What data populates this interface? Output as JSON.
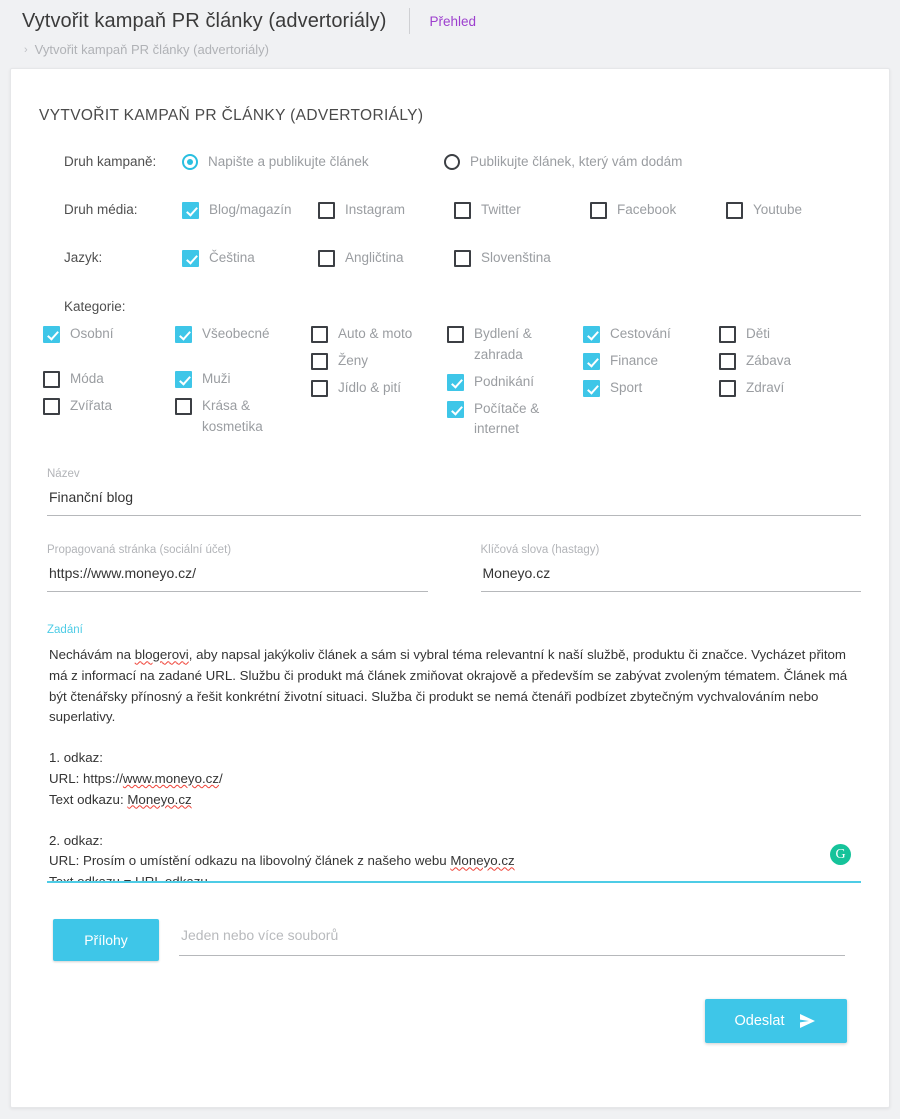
{
  "header": {
    "app_title": "Vytvořit kampaň PR články (advertoriály)",
    "overview_link": "Přehled",
    "breadcrumb_caret": "›",
    "breadcrumb_item": "Vytvořit kampaň PR články (advertoriály)"
  },
  "form": {
    "section_title": "VYTVOŘIT KAMPAŇ PR ČLÁNKY (ADVERTORIÁLY)",
    "campaign_type": {
      "label": "Druh kampaně:",
      "options": [
        {
          "label": "Napište a publikujte článek",
          "selected": true
        },
        {
          "label": "Publikujte článek, který vám dodám",
          "selected": false
        }
      ]
    },
    "media_type": {
      "label": "Druh média:",
      "options": [
        {
          "label": "Blog/magazín",
          "checked": true
        },
        {
          "label": "Instagram",
          "checked": false
        },
        {
          "label": "Twitter",
          "checked": false
        },
        {
          "label": "Facebook",
          "checked": false
        },
        {
          "label": "Youtube",
          "checked": false
        }
      ]
    },
    "language": {
      "label": "Jazyk:",
      "options": [
        {
          "label": "Čeština",
          "checked": true
        },
        {
          "label": "Angličtina",
          "checked": false
        },
        {
          "label": "Slovenština",
          "checked": false
        }
      ]
    },
    "categories": {
      "label": "Kategorie:",
      "columns": [
        [
          {
            "label": "Osobní",
            "checked": true
          },
          {
            "label": "Móda",
            "checked": false
          },
          {
            "label": "Zvířata",
            "checked": false
          }
        ],
        [
          {
            "label": "Všeobecné",
            "checked": true
          },
          {
            "label": "Muži",
            "checked": true
          },
          {
            "label": "Krása & kosmetika",
            "checked": false
          }
        ],
        [
          {
            "label": "Auto & moto",
            "checked": false
          },
          {
            "label": "Ženy",
            "checked": false
          },
          {
            "label": "Jídlo & pití",
            "checked": false
          }
        ],
        [
          {
            "label": "Bydlení & zahrada",
            "checked": false
          },
          {
            "label": "Podnikání",
            "checked": true
          },
          {
            "label": "Počítače & internet",
            "checked": true
          }
        ],
        [
          {
            "label": "Cestování",
            "checked": true
          },
          {
            "label": "Finance",
            "checked": true
          },
          {
            "label": "Sport",
            "checked": true
          }
        ],
        [
          {
            "label": "Děti",
            "checked": false
          },
          {
            "label": "Zábava",
            "checked": false
          },
          {
            "label": "Zdraví",
            "checked": false
          }
        ]
      ]
    },
    "name_field": {
      "label": "Název",
      "value": "Finanční blog",
      "placeholder": ""
    },
    "promoted_page_field": {
      "label": "Propagovaná stránka (sociální účet)",
      "value": "https://www.moneyo.cz/",
      "placeholder": ""
    },
    "keywords_field": {
      "label": "Klíčová slova (hastagy)",
      "value": "Moneyo.cz",
      "placeholder": ""
    },
    "brief": {
      "label": "Zadání",
      "paragraph": "Nechávám na blogerovi, aby napsal jakýkoliv článek a sám si vybral téma relevantní k naší službě, produktu či značce. Vycházet přitom má z informací na zadané URL. Službu či produkt má článek zmiňovat okrajově a především se zabývat zvoleným tématem. Článek má být čtenářsky přínosný a řešit konkrétní životní situaci. Služba či produkt se nemá čtenáři podbízet zbytečným vychvalováním nebo superlativy.",
      "link1_title": "1. odkaz:",
      "link1_url": "URL: https://www.moneyo.cz/",
      "link1_text": "Text odkazu: Moneyo.cz",
      "link2_title": "2. odkaz:",
      "link2_url": "URL: Prosím o umístění odkazu na libovolný článek z našeho webu Moneyo.cz",
      "link2_text": "Text odkazu = URL odkazu",
      "grammarly_glyph": "G"
    },
    "attachments": {
      "button_label": "Přílohy",
      "placeholder": "Jeden nebo více souborů",
      "value": ""
    },
    "submit": {
      "label": "Odeslat"
    }
  },
  "colors": {
    "accent": "#3ec6e8",
    "accent_light": "#4ecce6",
    "link_purple": "#9d3fce",
    "grammarly_green": "#15c39a",
    "page_bg": "#f0f1f3",
    "card_bg": "#ffffff",
    "muted_text": "#9a9da1"
  }
}
